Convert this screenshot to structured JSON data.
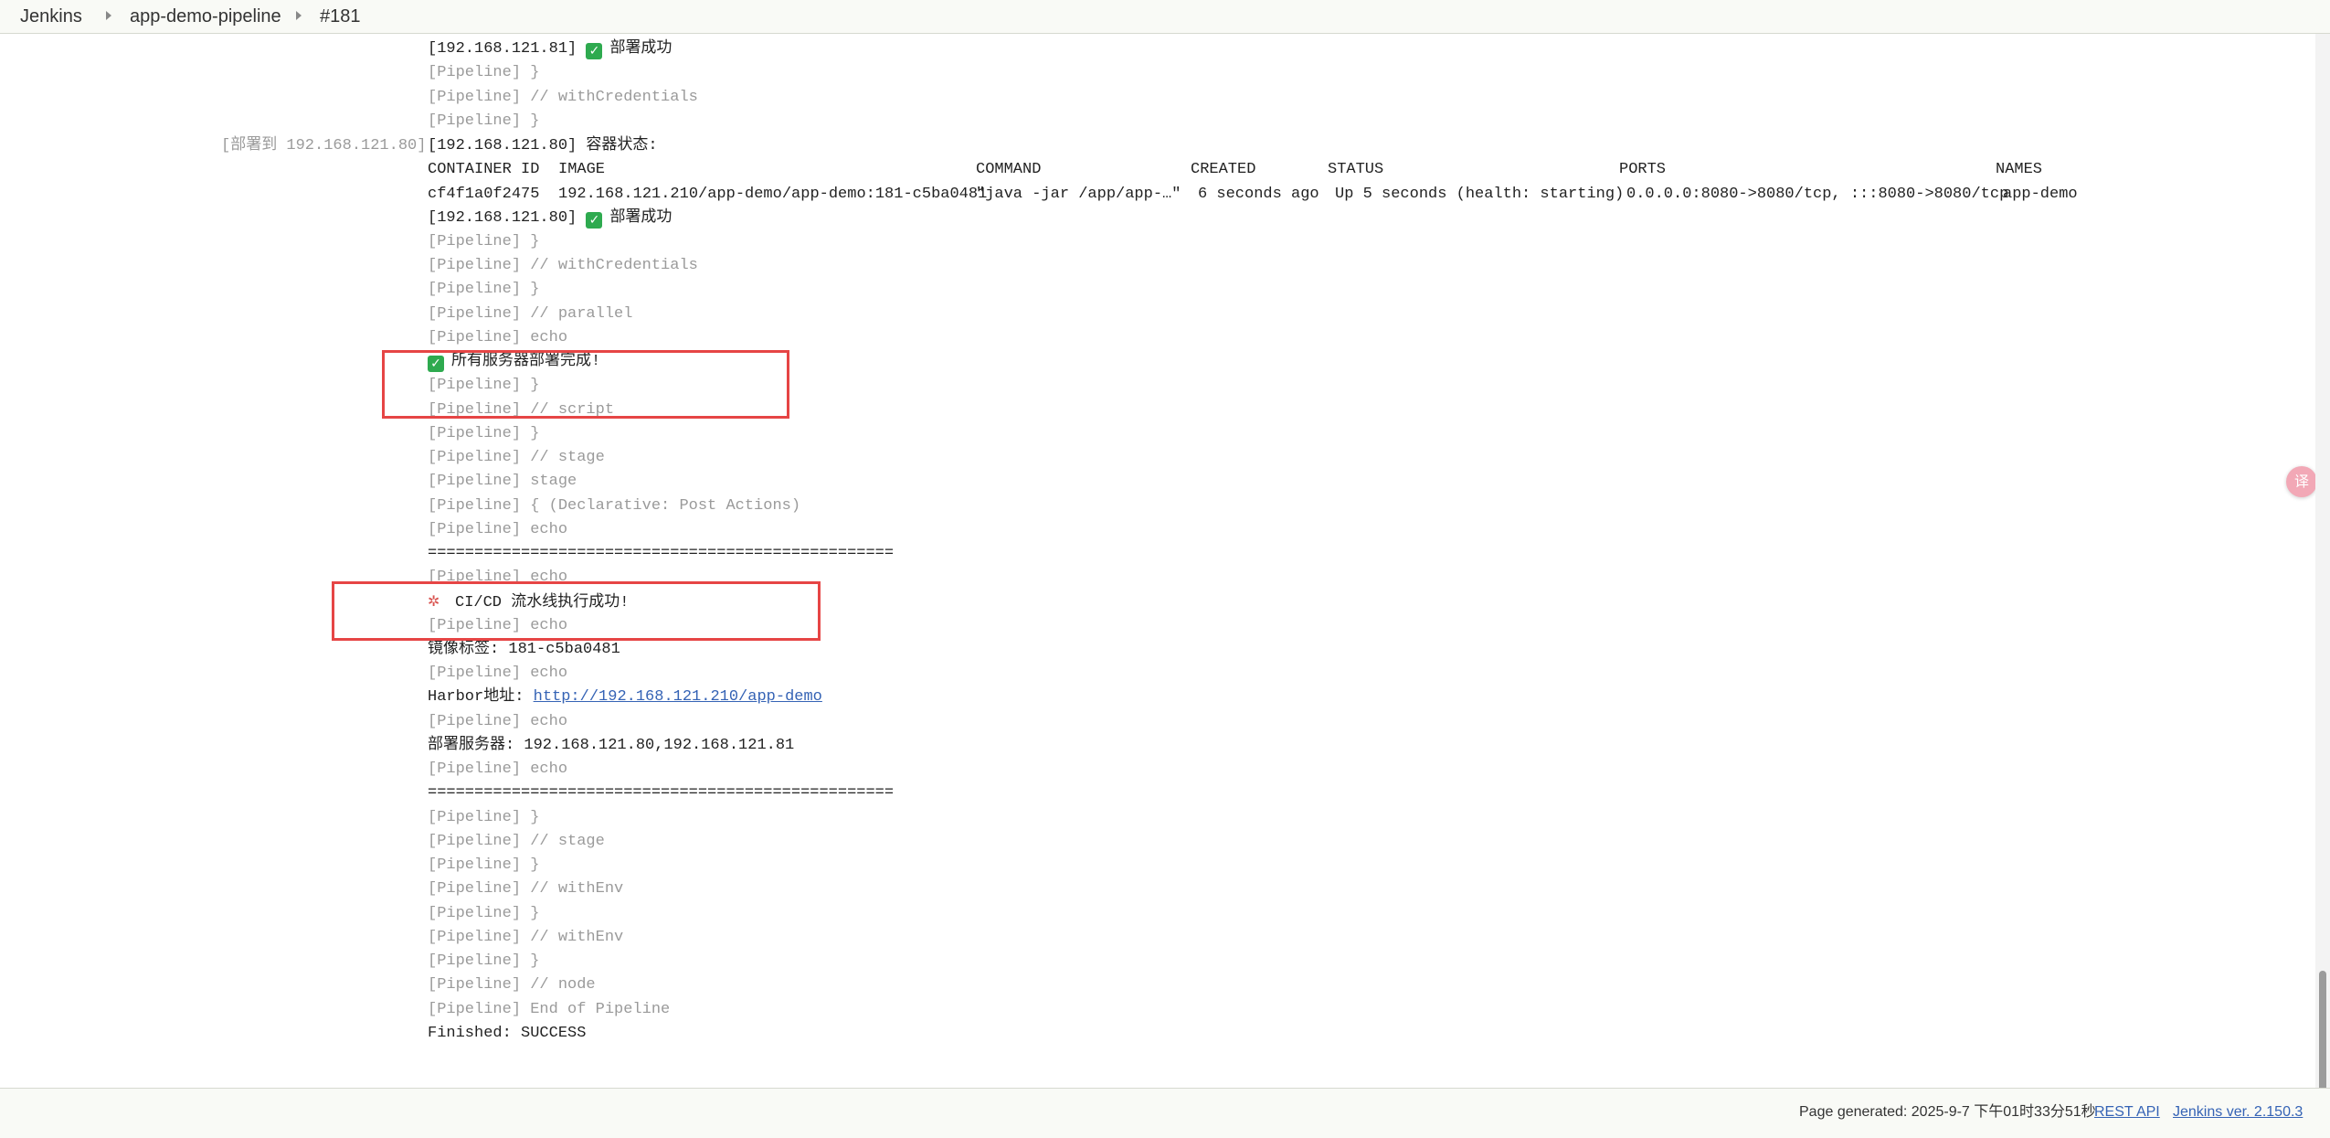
{
  "breadcrumb": {
    "items": [
      "Jenkins",
      "app-demo-pipeline",
      "#181"
    ]
  },
  "stage_label": "[部署到 192.168.121.80]",
  "container_table": {
    "headers": [
      "CONTAINER ID",
      "IMAGE",
      "COMMAND",
      "CREATED",
      "STATUS",
      "PORTS",
      "NAMES"
    ],
    "row": [
      "cf4f1a0f2475",
      "192.168.121.210/app-demo/app-demo:181-c5ba0481",
      "\"java -jar /app/app-…\"",
      "6 seconds ago",
      "Up 5 seconds (health: starting)",
      "0.0.0.0:8080->8080/tcp, :::8080->8080/tcp",
      "app-demo"
    ]
  },
  "log_lines": [
    "[192.168.121.81] ",
    "部署成功",
    "[Pipeline] }",
    "[Pipeline] // withCredentials",
    "[Pipeline] }",
    "[192.168.121.80] 容器状态:",
    "[192.168.121.80] ",
    "部署成功",
    "[Pipeline] }",
    "[Pipeline] // withCredentials",
    "[Pipeline] }",
    "[Pipeline] // parallel",
    "[Pipeline] echo",
    "所有服务器部署完成!",
    "[Pipeline] }",
    "[Pipeline] // script",
    "[Pipeline] }",
    "[Pipeline] // stage",
    "[Pipeline] stage",
    "[Pipeline] { (Declarative: Post Actions)",
    "[Pipeline] echo",
    "==================================================",
    "[Pipeline] echo",
    "CI/CD 流水线执行成功!",
    "[Pipeline] echo",
    "镜像标签: 181-c5ba0481",
    "[Pipeline] echo",
    "Harbor地址: ",
    "http://192.168.121.210/app-demo",
    "[Pipeline] echo",
    "部署服务器: 192.168.121.80,192.168.121.81",
    "[Pipeline] echo",
    "==================================================",
    "[Pipeline] }",
    "[Pipeline] // stage",
    "[Pipeline] }",
    "[Pipeline] // withEnv",
    "[Pipeline] }",
    "[Pipeline] // withEnv",
    "[Pipeline] }",
    "[Pipeline] // node",
    "[Pipeline] End of Pipeline",
    "Finished: SUCCESS"
  ],
  "icons": {
    "check": "check-icon",
    "party": "party-popper-icon",
    "translate": "translate-icon"
  },
  "floating_button": {
    "glyph": "译"
  },
  "colors": {
    "highlight": "#e64545",
    "check": "#2eaa4f",
    "link": "#3563b5",
    "dim_text": "#9a9a9a"
  },
  "footer": {
    "generated": "Page generated: 2025-9-7 下午01时33分51秒",
    "rest_api": "REST API",
    "version": "Jenkins ver. 2.150.3"
  }
}
